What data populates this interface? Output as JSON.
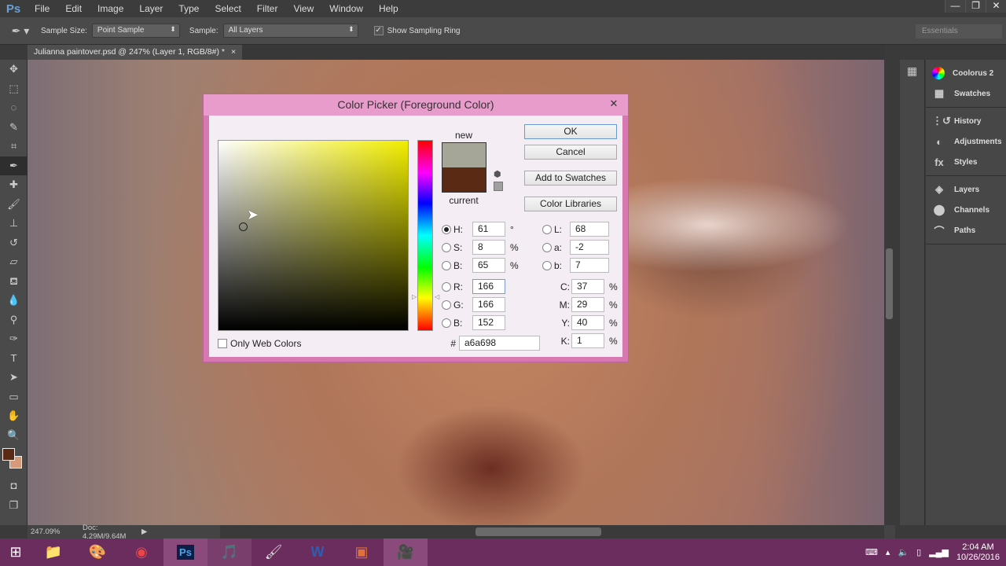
{
  "app": {
    "logo": "Ps",
    "menu": [
      "File",
      "Edit",
      "Image",
      "Layer",
      "Type",
      "Select",
      "Filter",
      "View",
      "Window",
      "Help"
    ],
    "window_controls": [
      "minimize",
      "restore",
      "close"
    ]
  },
  "options": {
    "sample_size_label": "Sample Size:",
    "sample_size_value": "Point Sample",
    "sample_label": "Sample:",
    "sample_value": "All Layers",
    "show_ring_label": "Show Sampling Ring",
    "show_ring_checked": true,
    "workspace": "Essentials"
  },
  "document": {
    "tab_title": "Julianna paintover.psd @ 247% (Layer 1, RGB/8#) *",
    "zoom": "247.09%",
    "doc_size": "Doc: 4.29M/9.64M"
  },
  "panels": {
    "groups": [
      [
        "Coolorus 2",
        "Swatches"
      ],
      [
        "History",
        "Adjustments",
        "Styles"
      ],
      [
        "Layers",
        "Channels",
        "Paths"
      ]
    ]
  },
  "dialog": {
    "title": "Color Picker (Foreground Color)",
    "new_label": "new",
    "current_label": "current",
    "new_color": "#a6a698",
    "current_color": "#5a2a14",
    "buttons": {
      "ok": "OK",
      "cancel": "Cancel",
      "add": "Add to Swatches",
      "libraries": "Color Libraries"
    },
    "only_web_colors": "Only Web Colors",
    "hsb": [
      {
        "label": "H:",
        "value": "61",
        "unit": "°",
        "selected": true
      },
      {
        "label": "S:",
        "value": "8",
        "unit": "%"
      },
      {
        "label": "B:",
        "value": "65",
        "unit": "%"
      }
    ],
    "rgb": [
      {
        "label": "R:",
        "value": "166"
      },
      {
        "label": "G:",
        "value": "166"
      },
      {
        "label": "B:",
        "value": "152"
      }
    ],
    "lab": [
      {
        "label": "L:",
        "value": "68"
      },
      {
        "label": "a:",
        "value": "-2"
      },
      {
        "label": "b:",
        "value": "7"
      }
    ],
    "cmyk": [
      {
        "label": "C:",
        "value": "37",
        "unit": "%"
      },
      {
        "label": "M:",
        "value": "29",
        "unit": "%"
      },
      {
        "label": "Y:",
        "value": "40",
        "unit": "%"
      },
      {
        "label": "K:",
        "value": "1",
        "unit": "%"
      }
    ],
    "hex_label": "#",
    "hex": "a6a698"
  },
  "taskbar": {
    "time": "2:04 AM",
    "date": "10/26/2016"
  }
}
